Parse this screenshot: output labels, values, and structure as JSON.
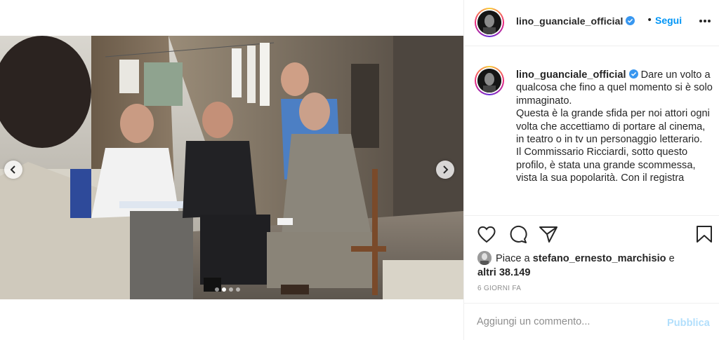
{
  "post": {
    "username": "lino_guanciale_official",
    "separator": "•",
    "follow_label": "Segui",
    "more_icon": "more-horizontal-icon",
    "verified_icon": "verified-badge-icon"
  },
  "carousel": {
    "total_slides": 4,
    "active_slide": 2,
    "prev_icon": "chevron-left-icon",
    "next_icon": "chevron-right-icon"
  },
  "caption": {
    "username": "lino_guanciale_official",
    "intro": "Dare un volto a qualcosa che fino a quel momento si è solo immaginato.",
    "paragraph_2": "Questa è la grande sfida per noi attori ogni volta che accettiamo di portare al cinema, in teatro o in tv un personaggio letterario.",
    "paragraph_3": "Il Commissario Ricciardi, sotto questo profilo, è stata una grande scommessa, vista la sua popolarità. Con il registra"
  },
  "actions": {
    "like_icon": "heart-icon",
    "comment_icon": "comment-bubble-icon",
    "share_icon": "paper-plane-icon",
    "save_icon": "bookmark-icon"
  },
  "likes": {
    "prefix": "Piace a",
    "liker": "stefano_ernesto_marchisio",
    "conjunction": "e",
    "others": "altri 38.149"
  },
  "timestamp": "6 GIORNI FA",
  "comment": {
    "placeholder": "Aggiungi un commento...",
    "publish_label": "Pubblica"
  },
  "colors": {
    "accent": "#0095f6",
    "publish_disabled": "#b2dffc",
    "muted": "#8e8e8e",
    "text": "#262626"
  }
}
